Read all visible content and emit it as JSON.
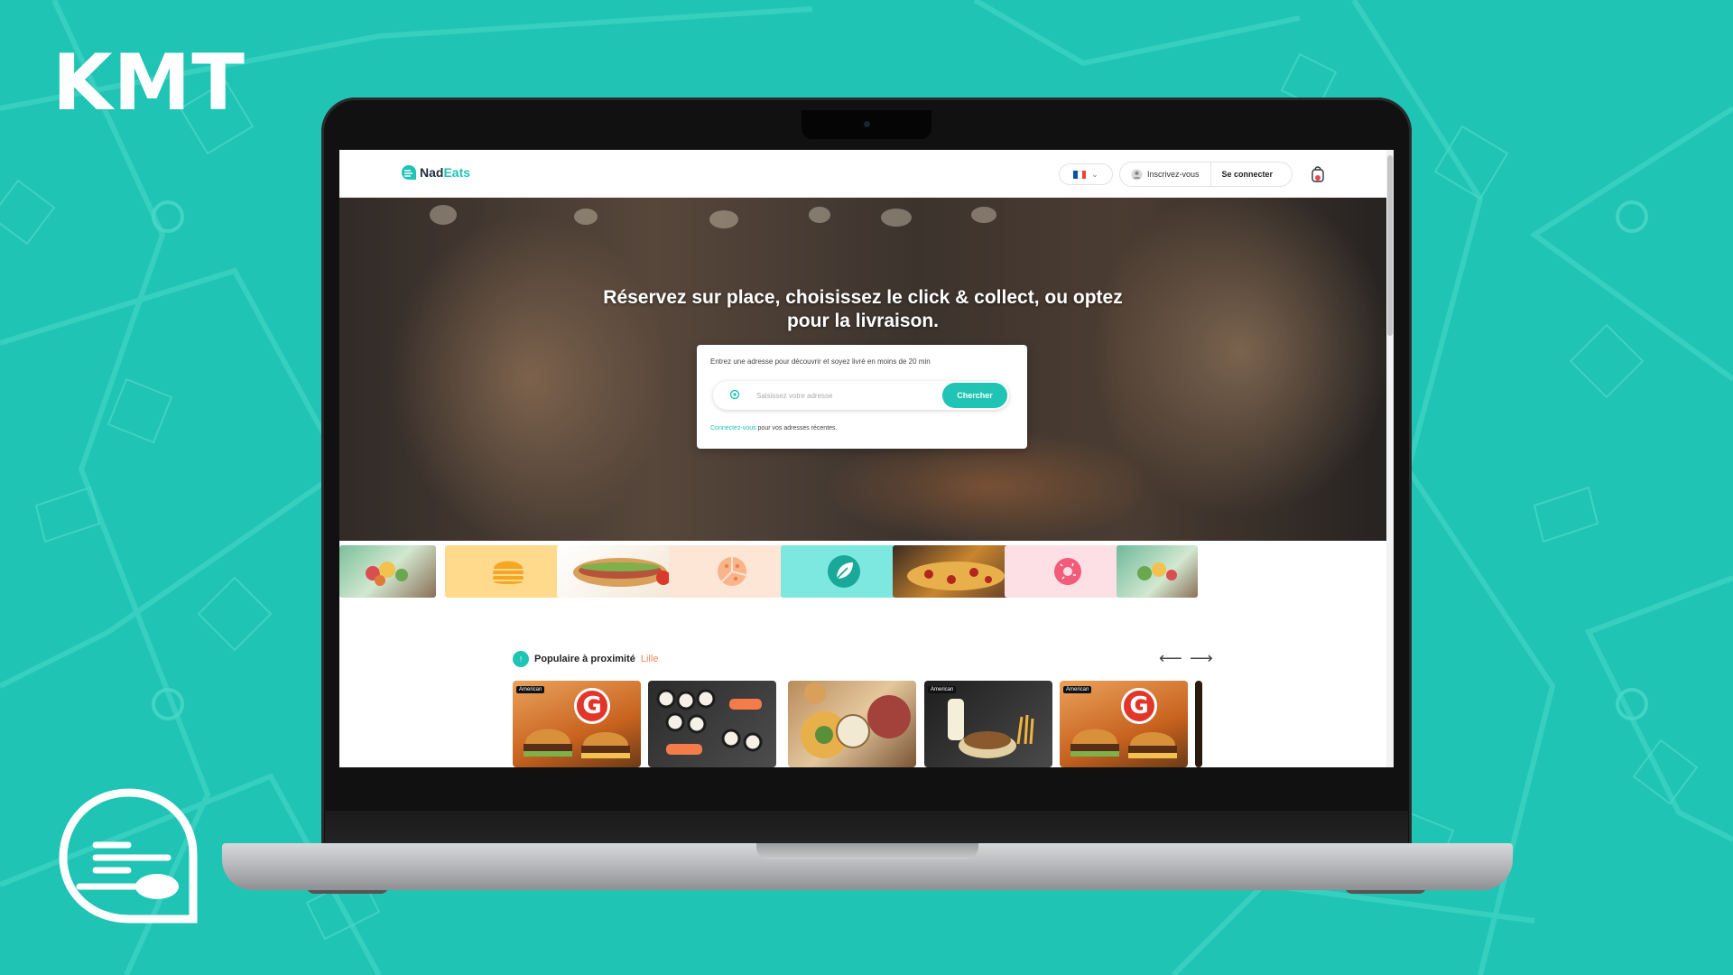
{
  "brand": {
    "name": "KMT",
    "logo_icon": "fork-spoon-icon"
  },
  "site": {
    "logo_text_main": "Nad",
    "logo_text_accent": "Eats",
    "language": {
      "flag": "french-flag-icon",
      "colors": [
        "#0055a4",
        "#ffffff",
        "#ef4135"
      ]
    },
    "signup_label": "Inscrivez-vous",
    "login_label": "Se connecter",
    "cart_icon": "bag-icon"
  },
  "hero": {
    "title": "Réservez sur place, choisissez le click & collect, ou optez pour la livraison.",
    "search_hint": "Entrez une adresse pour découvrir et soyez livré en moins de 20 min",
    "search_placeholder": "Saisissez votre adresse",
    "search_button": "Chercher",
    "login_link": "Connectez-vous",
    "login_suffix": " pour vos adresses récentes."
  },
  "categories": [
    {
      "icon": "vegetables-icon"
    },
    {
      "icon": "burger-icon"
    },
    {
      "icon": "sandwich-icon"
    },
    {
      "icon": "pizza-icon"
    },
    {
      "icon": "leaf-icon"
    },
    {
      "icon": "pizza-photo-icon"
    },
    {
      "icon": "donut-icon"
    },
    {
      "icon": "vegetables-icon"
    }
  ],
  "popular": {
    "badge": "!",
    "title": "Populaire à proximité",
    "city": "Lille",
    "prev_icon": "arrow-left-icon",
    "next_icon": "arrow-right-icon",
    "cards": [
      {
        "tag": "American",
        "badge": "G"
      },
      {
        "tag": ""
      },
      {
        "tag": ""
      },
      {
        "tag": "American"
      },
      {
        "tag": "American",
        "badge": "G"
      }
    ]
  },
  "colors": {
    "accent": "#1fc4b4",
    "city": "#f08a5d",
    "background": "#1fc4b4"
  }
}
